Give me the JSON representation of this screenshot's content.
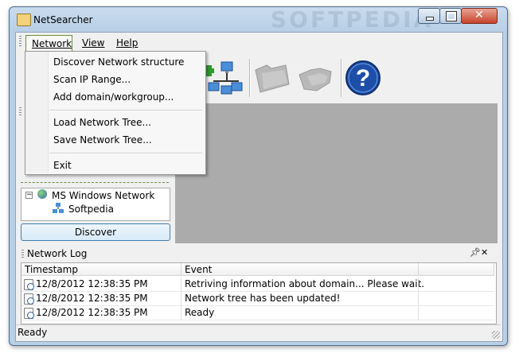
{
  "window": {
    "title": "NetSearcher",
    "status": "Ready"
  },
  "menubar": {
    "network": "Network",
    "view": "View",
    "help": "Help"
  },
  "network_menu": {
    "items": [
      {
        "label": "Discover Network structure"
      },
      {
        "label": "Scan IP Range..."
      },
      {
        "label": "Add domain/workgroup..."
      },
      {
        "label": "Load Network Tree..."
      },
      {
        "label": "Save Network Tree..."
      },
      {
        "label": "Exit"
      }
    ]
  },
  "tree": {
    "root": "MS Windows Network",
    "child": "Softpedia"
  },
  "discover_button": "Discover",
  "watermark": "SOFTPEDIA",
  "log": {
    "title": "Network Log",
    "columns": [
      "Timestamp",
      "Event"
    ],
    "rows": [
      {
        "timestamp": "12/8/2012 12:38:35 PM",
        "event": "Retriving information about domain... Please wait."
      },
      {
        "timestamp": "12/8/2012 12:38:35 PM",
        "event": "Network tree has been updated!"
      },
      {
        "timestamp": "12/8/2012 12:38:35 PM",
        "event": "Ready"
      }
    ]
  },
  "colors": {
    "accent_border": "#6b8d3f",
    "view_area": "#ababab",
    "help_icon": "#1e4fa8"
  },
  "icons": [
    "app-folder-icon",
    "add-network-icon",
    "disabled-folder-icon",
    "disabled-hand-icon",
    "help-icon",
    "pin-icon",
    "close-icon"
  ]
}
